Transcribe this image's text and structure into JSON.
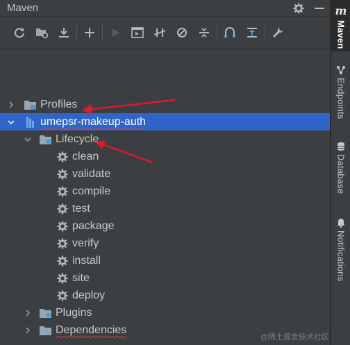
{
  "panel": {
    "title": "Maven"
  },
  "toolbar": {
    "buttons": [
      {
        "name": "reload-icon"
      },
      {
        "name": "add-folder-icon"
      },
      {
        "name": "download-icon"
      },
      {
        "name": "add-icon"
      },
      {
        "name": "run-icon"
      },
      {
        "name": "run-config-icon"
      },
      {
        "name": "toggle-offline-icon"
      },
      {
        "name": "skip-tests-icon"
      },
      {
        "name": "collapse-all-icon"
      },
      {
        "name": "analyze-dependencies-icon"
      },
      {
        "name": "show-dependencies-icon"
      },
      {
        "name": "settings-wrench-icon"
      }
    ]
  },
  "tree": {
    "profiles": "Profiles",
    "project": "umepsr-makeup-auth",
    "lifecycle": "Lifecycle",
    "goals": [
      "clean",
      "validate",
      "compile",
      "test",
      "package",
      "verify",
      "install",
      "site",
      "deploy"
    ],
    "plugins": "Plugins",
    "dependencies": "Dependencies"
  },
  "side_tabs": {
    "maven": "Maven",
    "endpoints": "Endpoints",
    "database": "Database",
    "notifications": "Notifications"
  },
  "watermark": "@稀土掘金技术社区",
  "colors": {
    "background": "#3c3f41",
    "selection": "#2f65ca",
    "annotation_arrow": "#e0192b"
  }
}
